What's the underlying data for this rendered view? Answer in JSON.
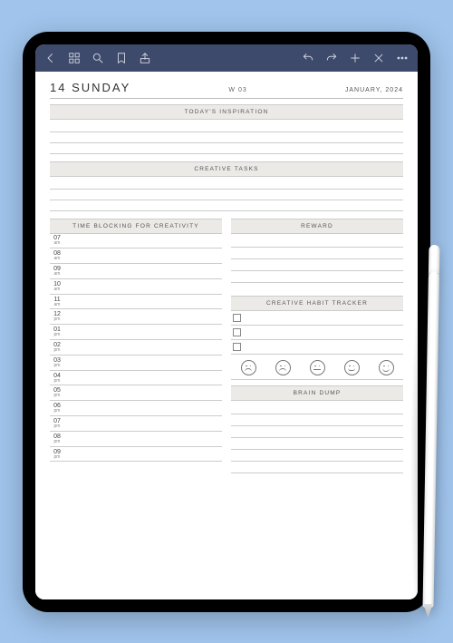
{
  "header": {
    "day_number": "14",
    "day_name": "SUNDAY",
    "week": "W 03",
    "month": "JANUARY, 2024"
  },
  "sections": {
    "inspiration": "TODAY'S INSPIRATION",
    "creative_tasks": "CREATIVE TASKS",
    "time_blocking": "TIME BLOCKING FOR CREATIVITY",
    "reward": "REWARD",
    "habit_tracker": "CREATIVE HABIT TRACKER",
    "brain_dump": "BRAIN DUMP"
  },
  "time_slots": [
    {
      "hr": "07",
      "ap": "am"
    },
    {
      "hr": "08",
      "ap": "am"
    },
    {
      "hr": "09",
      "ap": "am"
    },
    {
      "hr": "10",
      "ap": "am"
    },
    {
      "hr": "11",
      "ap": "am"
    },
    {
      "hr": "12",
      "ap": "pm"
    },
    {
      "hr": "01",
      "ap": "pm"
    },
    {
      "hr": "02",
      "ap": "pm"
    },
    {
      "hr": "03",
      "ap": "pm"
    },
    {
      "hr": "04",
      "ap": "pm"
    },
    {
      "hr": "05",
      "ap": "pm"
    },
    {
      "hr": "06",
      "ap": "pm"
    },
    {
      "hr": "07",
      "ap": "pm"
    },
    {
      "hr": "08",
      "ap": "pm"
    },
    {
      "hr": "09",
      "ap": "pm"
    }
  ],
  "habit_count": 3,
  "moods": [
    "very-sad",
    "sad",
    "neutral",
    "happy",
    "very-happy"
  ],
  "toolbar_icons": {
    "left": [
      "back",
      "grid",
      "search",
      "bookmark",
      "share"
    ],
    "right": [
      "undo",
      "redo",
      "add",
      "close",
      "more"
    ]
  }
}
